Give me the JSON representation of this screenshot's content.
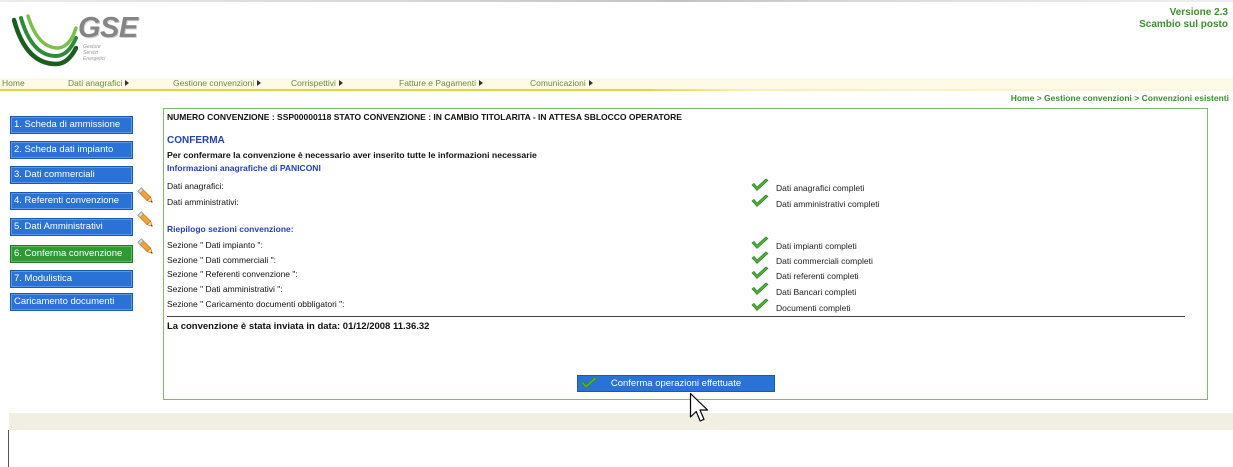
{
  "header": {
    "logo": {
      "text": "GSE",
      "subtitle": [
        "Gestore",
        "Servizi",
        "Energetici"
      ]
    },
    "version": "Versione 2.3",
    "service": "Scambio sul posto"
  },
  "nav": {
    "items": [
      {
        "label": "Home",
        "has_submenu": false
      },
      {
        "label": "Dati anagrafici",
        "has_submenu": true
      },
      {
        "label": "Gestione convenzioni",
        "has_submenu": true
      },
      {
        "label": "Corrispettivi",
        "has_submenu": true
      },
      {
        "label": "Fatture e Pagamenti",
        "has_submenu": true
      },
      {
        "label": "Comunicazioni",
        "has_submenu": true
      }
    ],
    "submenu_icon": "submenu-arrow-icon"
  },
  "breadcrumb": {
    "items": [
      "Home",
      "Gestione convenzioni",
      "Convenzioni esistenti"
    ],
    "separator": ">"
  },
  "sidebar": {
    "items": [
      {
        "label": "1. Scheda di ammissione",
        "active": false,
        "edit_icon": false
      },
      {
        "label": "2. Scheda dati impianto",
        "active": false,
        "edit_icon": false
      },
      {
        "label": "3. Dati commerciali",
        "active": false,
        "edit_icon": false
      },
      {
        "label": "4. Referenti convenzione",
        "active": false,
        "edit_icon": true
      },
      {
        "label": "5. Dati Amministrativi",
        "active": false,
        "edit_icon": true
      },
      {
        "label": "6. Conferma convenzione",
        "active": true,
        "edit_icon": true
      },
      {
        "label": "7. Modulistica",
        "active": false,
        "edit_icon": false
      },
      {
        "label": "Caricamento documenti",
        "active": false,
        "edit_icon": false
      }
    ],
    "edit_icon_name": "pencil-icon"
  },
  "main": {
    "convention_header": "NUMERO CONVENZIONE : SSP00000118 STATO CONVENZIONE : IN CAMBIO TITOLARITA - IN ATTESA SBLOCCO OPERATORE",
    "title": "CONFERMA",
    "instruction": "Per confermare la convenzione è necessario aver inserito tutte le informazioni necessarie",
    "registry_heading": "Informazioni anagrafiche di PANICONI",
    "registry_rows": [
      {
        "label": "Dati anagrafici:",
        "status": "Dati anagrafici completi",
        "status_icon": "check-icon"
      },
      {
        "label": "Dati amministrativi:",
        "status": "Dati amministrativi completi",
        "status_icon": "check-icon"
      }
    ],
    "summary_heading": "Riepilogo sezioni convenzione:",
    "summary_rows": [
      {
        "label": "Sezione \" Dati impianto \":",
        "status": "Dati impianti completi",
        "status_icon": "check-icon"
      },
      {
        "label": "Sezione \" Dati commerciali \":",
        "status": "Dati commerciali completi",
        "status_icon": "check-icon"
      },
      {
        "label": "Sezione \" Referenti convenzione \":",
        "status": "Dati referenti completi",
        "status_icon": "check-icon"
      },
      {
        "label": "Sezione \" Dati amministrativi \":",
        "status": "Dati Bancari completi",
        "status_icon": "check-icon"
      },
      {
        "label": "Sezione \" Caricamento documenti obbligatori \":",
        "status": "Documenti completi",
        "status_icon": "check-icon"
      }
    ],
    "sent_info": "La convenzione è stata inviata in data: 01/12/2008 11.36.32",
    "confirm_button": {
      "label": "Conferma operazioni effettuate",
      "icon": "check-icon"
    }
  },
  "colors": {
    "sidebar_button": "#2a72d6",
    "sidebar_active": "#2f9a33",
    "brand_green": "#3b8f2f",
    "heading_blue": "#2342b5",
    "panel_border": "#7dbb6f",
    "nav_background": "#fdfbe6",
    "nav_underline": "#e9d23c",
    "check_green": "#4caf3a",
    "footer_band": "#f0efe2"
  }
}
